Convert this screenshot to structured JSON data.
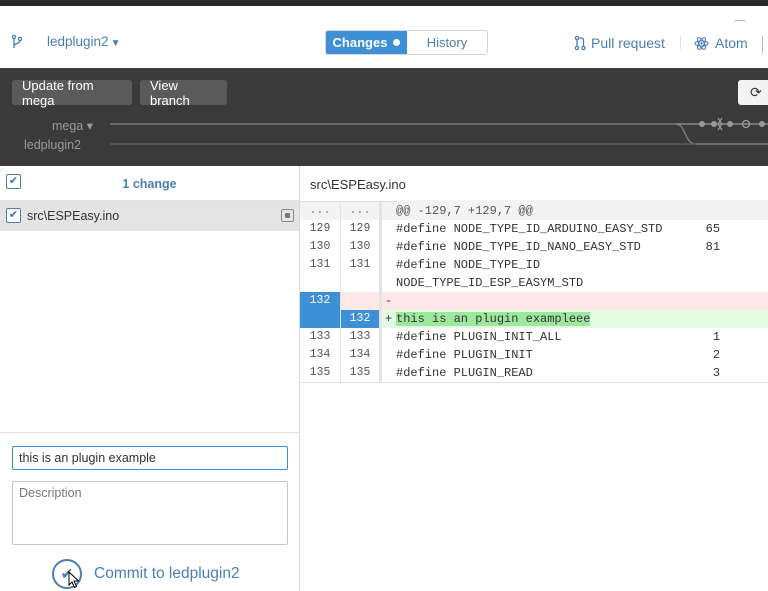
{
  "toolbar": {
    "repo_name": "ledplugin2",
    "tabs": {
      "changes": "Changes",
      "history": "History"
    },
    "pull_request": "Pull request",
    "editor": "Atom",
    "icons": {
      "branch": "git-branch-icon",
      "pull_request": "pull-request-icon",
      "atom": "atom-icon",
      "caret": "caret-down-icon"
    }
  },
  "branchbar": {
    "update_button": "Update from mega",
    "view_branch_button": "View branch",
    "sync_icon": "sync-icon",
    "branch_mega": "mega ▾",
    "branch_local": "ledplugin2"
  },
  "changes_panel": {
    "count_label": "1 change",
    "files": [
      {
        "name": "src\\ESPEasy.ino",
        "checked": true,
        "status_icon": "modified-icon"
      }
    ],
    "summary_value": "this is an plugin example",
    "description_placeholder": "Description",
    "commit_label": "Commit to ledplugin2"
  },
  "diff": {
    "path": "src\\ESPEasy.ino",
    "hunk": {
      "old": "...",
      "new": "...",
      "text": "@@ -129,7 +129,7 @@"
    },
    "lines": [
      {
        "old": "129",
        "new": "129",
        "marker": "",
        "text": "#define NODE_TYPE_ID_ARDUINO_EASY_STD      65"
      },
      {
        "old": "130",
        "new": "130",
        "marker": "",
        "text": "#define NODE_TYPE_ID_NANO_EASY_STD         81"
      },
      {
        "old": "131",
        "new": "131",
        "marker": "",
        "text": "#define NODE_TYPE_ID\nNODE_TYPE_ID_ESP_EASYM_STD"
      },
      {
        "old": "132",
        "new": "",
        "marker": "-",
        "text": ""
      },
      {
        "old": "",
        "new": "132",
        "marker": "+",
        "text": "this is an plugin exampleee"
      },
      {
        "old": "133",
        "new": "133",
        "marker": "",
        "text": "#define PLUGIN_INIT_ALL                     1"
      },
      {
        "old": "134",
        "new": "134",
        "marker": "",
        "text": "#define PLUGIN_INIT                         2"
      },
      {
        "old": "135",
        "new": "135",
        "marker": "",
        "text": "#define PLUGIN_READ                         3"
      }
    ]
  },
  "colors": {
    "accent": "#3d8fd6",
    "link": "#4a7fb5",
    "dark_bar": "#3a3a3a",
    "added": "#e2fbe2",
    "removed": "#fde7e7"
  }
}
